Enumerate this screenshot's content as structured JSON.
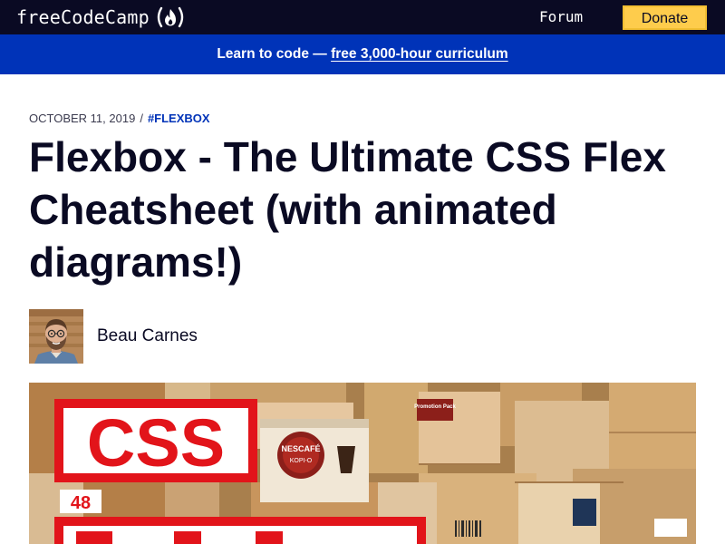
{
  "nav": {
    "logo_text": "freeCodeCamp",
    "logo_icon": "flame-icon",
    "forum_label": "Forum",
    "donate_label": "Donate"
  },
  "banner": {
    "text": "Learn to code — ",
    "link_text": "free 3,000-hour curriculum"
  },
  "article": {
    "date": "OCTOBER 11, 2019",
    "separator": "/",
    "tag": "#FLEXBOX",
    "title": "Flexbox - The Ultimate CSS Flex Cheatsheet (with animated diagrams!)",
    "author": {
      "name": "Beau Carnes"
    },
    "feature_image": {
      "css_text": "CSS",
      "cup_brand": "NESCAFÉ",
      "cup_label": "KOPI-O",
      "box_label_left": "48",
      "box_label_right": "Promotion Pack"
    }
  },
  "colors": {
    "nav_bg": "#0a0a23",
    "banner_bg": "#0033b8",
    "donate_bg": "#fecc4c",
    "tag_color": "#0033b8",
    "title_color": "#0a0a23",
    "css_red": "#e2141a"
  }
}
